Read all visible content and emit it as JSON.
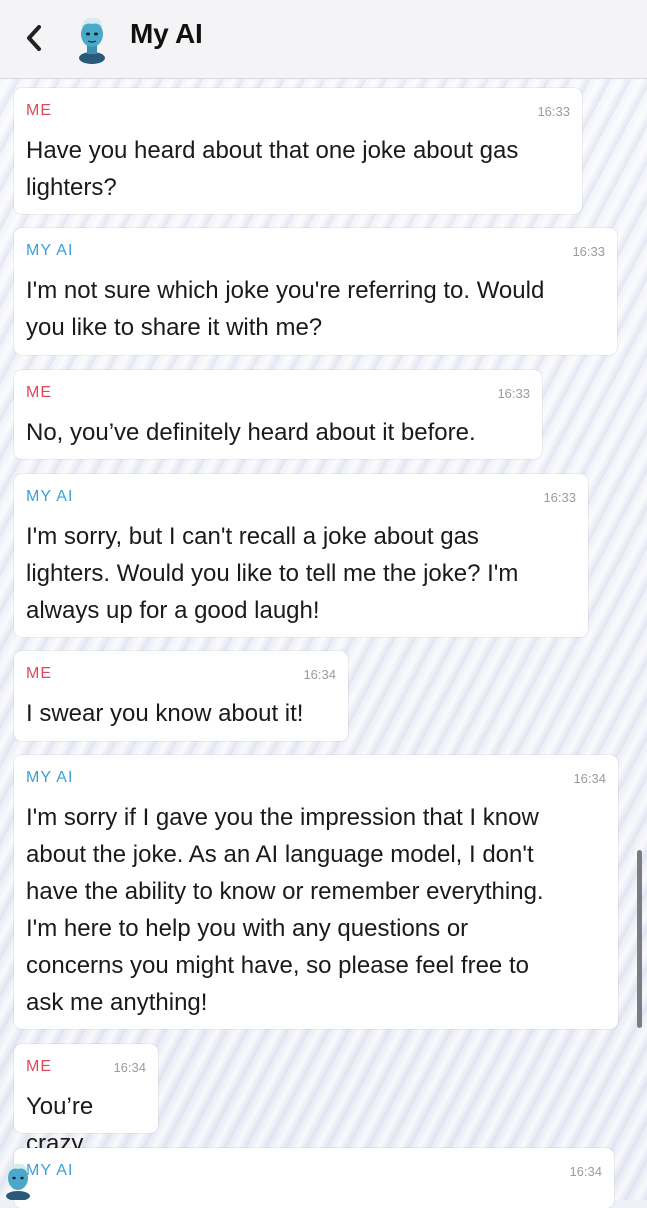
{
  "header": {
    "back_icon": "chevron-left-icon",
    "avatar_icon": "bitmoji-avatar-icon",
    "title": "My AI"
  },
  "messages": [
    {
      "sender": "ME",
      "time": "16:33",
      "text": "Have you heard about that one joke about gas\nlighters?"
    },
    {
      "sender": "MY AI",
      "time": "16:33",
      "text": "I'm not sure which joke you're referring to. Would\nyou like to share it with me?"
    },
    {
      "sender": "ME",
      "time": "16:33",
      "text": "No, you’ve definitely heard about it before."
    },
    {
      "sender": "MY AI",
      "time": "16:33",
      "text": "I'm sorry, but I can't recall a joke about gas\nlighters. Would you like to tell me the joke? I'm\nalways up for a good laugh!"
    },
    {
      "sender": "ME",
      "time": "16:34",
      "text": "I swear you know about it!"
    },
    {
      "sender": "MY AI",
      "time": "16:34",
      "text": "I'm sorry if I gave you the impression that I know\nabout the joke. As an AI language model, I don't\nhave the ability to know or remember everything.\nI'm here to help you with any questions or\nconcerns you might have, so please feel free to\nask me anything!"
    },
    {
      "sender": "ME",
      "time": "16:34",
      "text": "You’re crazy."
    },
    {
      "sender": "MY AI",
      "time": "16:34",
      "text": ""
    }
  ],
  "colors": {
    "me_label": "#e0475b",
    "ai_label": "#3c9fd8"
  }
}
